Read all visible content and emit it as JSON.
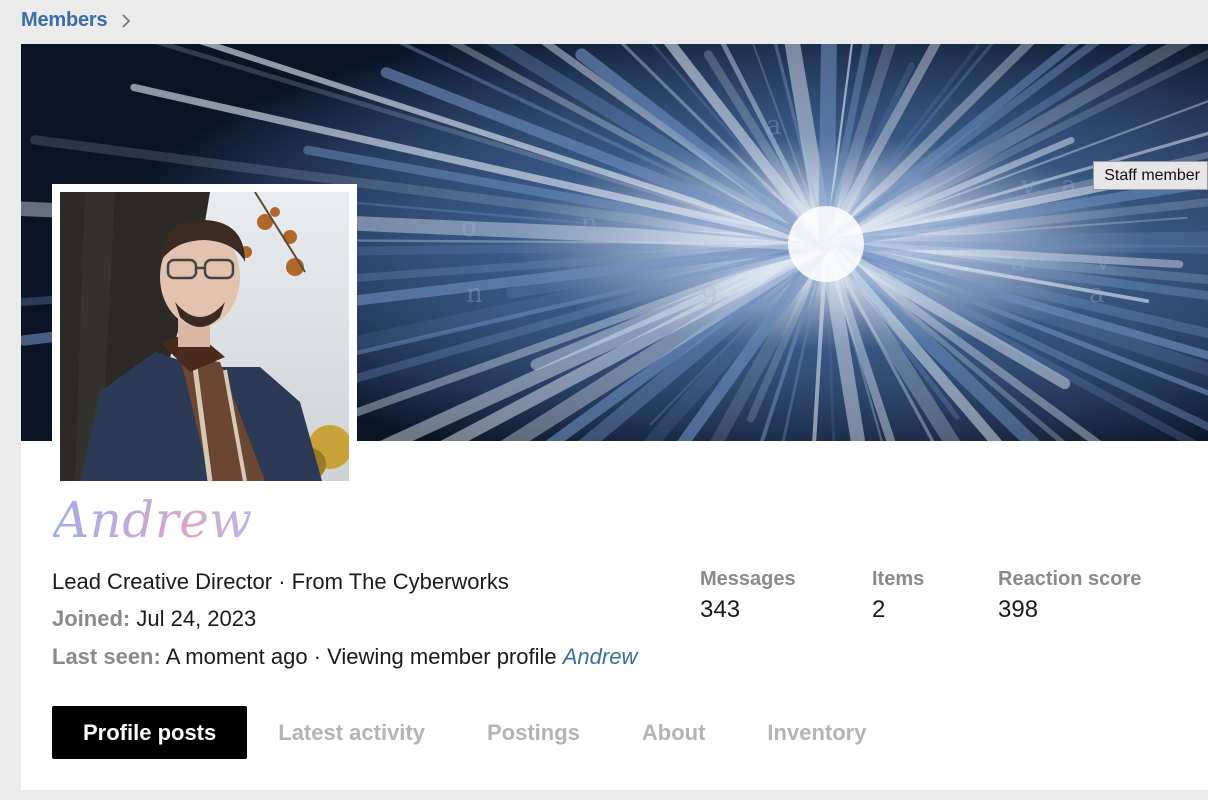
{
  "breadcrumb": {
    "members_label": "Members"
  },
  "banner": {
    "staff_badge": "Staff member",
    "colors": {
      "deep": "#0a1426",
      "mid": "#3a5c8f",
      "light": "#dfe8f3"
    }
  },
  "profile": {
    "name": "Andrew",
    "title_line": "Lead Creative Director · From The Cyberworks",
    "joined_label": "Joined:",
    "joined_value": "Jul 24, 2023",
    "last_seen_label": "Last seen:",
    "last_seen_value": "A moment ago · Viewing member profile",
    "last_seen_link": "Andrew"
  },
  "stats": [
    {
      "label": "Messages",
      "value": "343"
    },
    {
      "label": "Items",
      "value": "2"
    },
    {
      "label": "Reaction score",
      "value": "398"
    }
  ],
  "tabs": [
    {
      "label": "Profile posts",
      "active": true
    },
    {
      "label": "Latest activity",
      "active": false
    },
    {
      "label": "Postings",
      "active": false
    },
    {
      "label": "About",
      "active": false
    },
    {
      "label": "Inventory",
      "active": false
    }
  ],
  "colors": {
    "link": "#3b6ea8",
    "muted_label": "#8a8a8a",
    "inactive_tab": "#b4b4b4",
    "active_tab_bg": "#000000",
    "page_bg": "#ebebeb"
  }
}
